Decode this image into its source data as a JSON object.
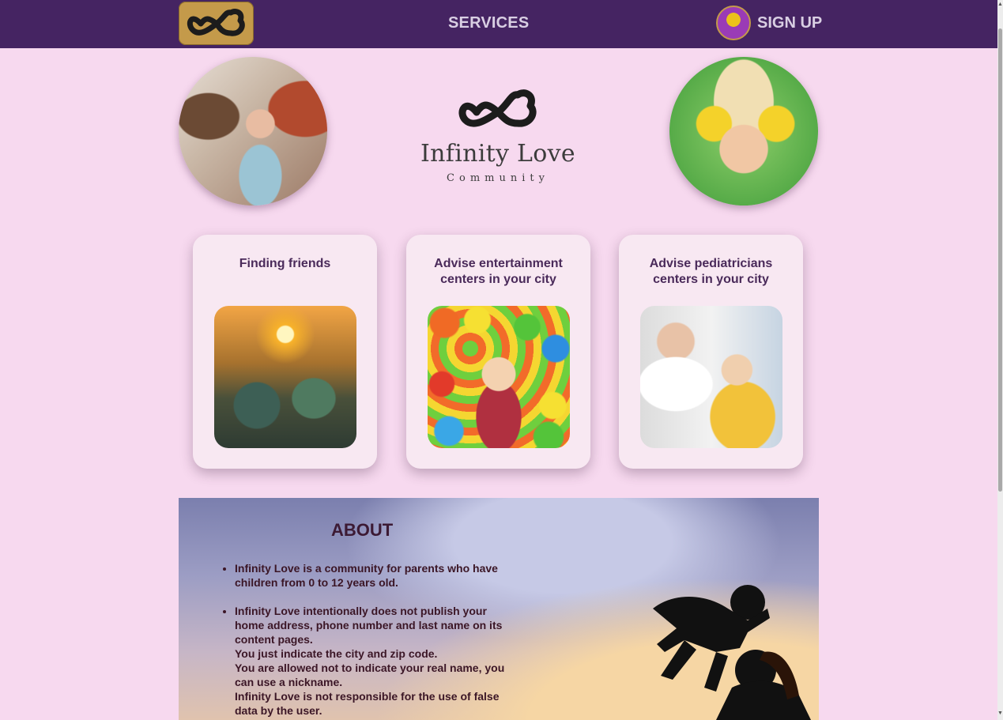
{
  "nav": {
    "services_label": "SERVICES",
    "signup_label": "SIGN UP"
  },
  "hero": {
    "brand_name": "Infinity Love",
    "brand_sub": "Community"
  },
  "cards": [
    {
      "title": "Finding friends"
    },
    {
      "title": "Advise entertainment centers in your city"
    },
    {
      "title": "Advise pediatricians centers in your city"
    }
  ],
  "about": {
    "title": "ABOUT",
    "items": [
      [
        "Infinity Love is a community for parents who have children from 0 to 12 years old."
      ],
      [
        "Infinity Love intentionally does not publish your home address, phone number and last name on its content pages.",
        "You just indicate the city and zip code.",
        "You are allowed not to indicate your real name, you can use a nickname.",
        "Infinity Love is not responsible for the use of false data by the user."
      ]
    ]
  },
  "colors": {
    "nav_bg": "#452462",
    "page_bg": "#f7d9ef",
    "accent_gold": "#c49a4a",
    "card_title": "#4a2a5a"
  },
  "icons": {
    "logo": "infinity-heart-logo-icon",
    "avatar": "user-avatar-icon"
  }
}
